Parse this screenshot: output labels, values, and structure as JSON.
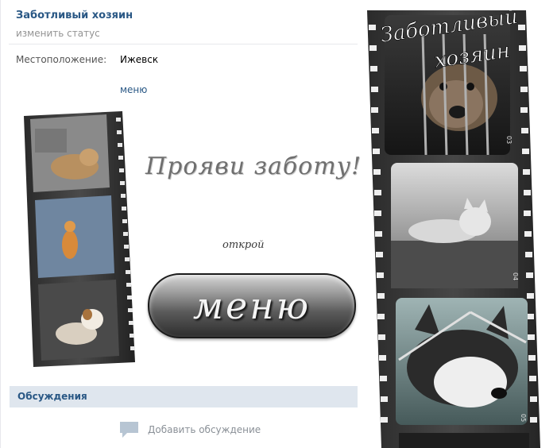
{
  "profile": {
    "name": "Заботливый хозяин",
    "status_link": "изменить статус",
    "location_label": "Местоположение:",
    "location_value": "Ижевск",
    "menu_link": "меню"
  },
  "promo": {
    "slogan": "Прояви заботу!",
    "open_text": "открой",
    "button_label": "меню"
  },
  "film_poster": {
    "title_line1": "Заботливый",
    "title_line2": "хозяин",
    "frame_numbers": [
      "03",
      "04",
      "05"
    ]
  },
  "discussions": {
    "title": "Обсуждения",
    "add_label": "Добавить обсуждение"
  }
}
